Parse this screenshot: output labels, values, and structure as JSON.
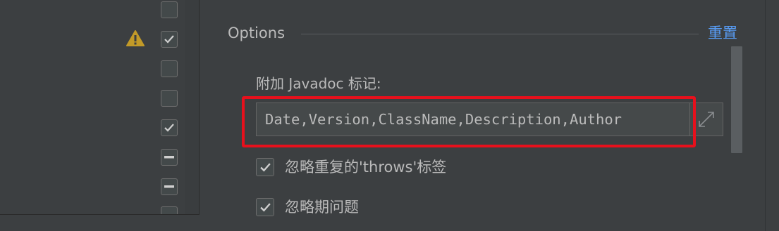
{
  "left_list": {
    "checkboxes": [
      {
        "state": "unchecked"
      },
      {
        "state": "checked",
        "warning": true
      },
      {
        "state": "unchecked"
      },
      {
        "state": "unchecked"
      },
      {
        "state": "checked"
      },
      {
        "state": "indeterminate"
      },
      {
        "state": "indeterminate"
      },
      {
        "state": "indeterminate"
      }
    ],
    "warning_icon": "warning-triangle-icon",
    "warning_color": "#c29a28"
  },
  "options": {
    "title": "Options",
    "reset_label": "重置",
    "javadoc_tags": {
      "label": "附加 Javadoc 标记:",
      "value": "Date,Version,ClassName,Description,Author",
      "expand_icon": "expand-arrows-icon"
    },
    "checks": [
      {
        "label": "忽略重复的'throws'标签",
        "checked": true
      },
      {
        "label": "忽略期问题",
        "checked": true
      }
    ]
  },
  "colors": {
    "background": "#3c3f41",
    "text": "#bbbbbb",
    "link": "#589df6",
    "highlight": "#e8101c"
  }
}
